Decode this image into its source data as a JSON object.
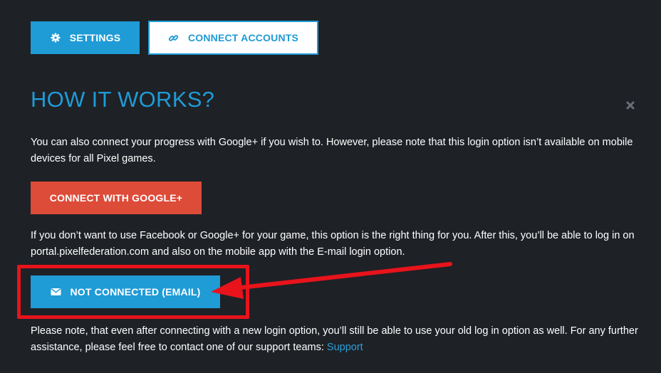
{
  "toolbar": {
    "settings_label": "SETTINGS",
    "settings_icon": "gear-icon",
    "connect_accounts_label": "CONNECT ACCOUNTS",
    "connect_accounts_icon": "link-icon"
  },
  "section": {
    "title": "HOW IT WORKS?",
    "close_icon": "close-icon"
  },
  "google": {
    "description": "You can also connect your progress with Google+ if you wish to. However, please note that this login option isn’t available on mobile devices for all Pixel games.",
    "button_label": "CONNECT WITH GOOGLE+"
  },
  "email": {
    "description": "If you don’t want to use Facebook or Google+ for your game, this option is the right thing for you. After this, you’ll be able to log in on portal.pixelfederation.com and also on the mobile app with the E-mail login option.",
    "button_label": "NOT CONNECTED (EMAIL)",
    "button_icon": "envelope-icon"
  },
  "footer": {
    "note": "Please note, that even after connecting with a new login option, you’ll still be able to use your old log in option as well. For any further assistance, please feel free to contact one of our support teams: ",
    "support_link": "Support"
  },
  "colors": {
    "background": "#1e2126",
    "accent_blue": "#1f9bd6",
    "google_red": "#dd4b39",
    "annotation_red": "#e8131b"
  }
}
